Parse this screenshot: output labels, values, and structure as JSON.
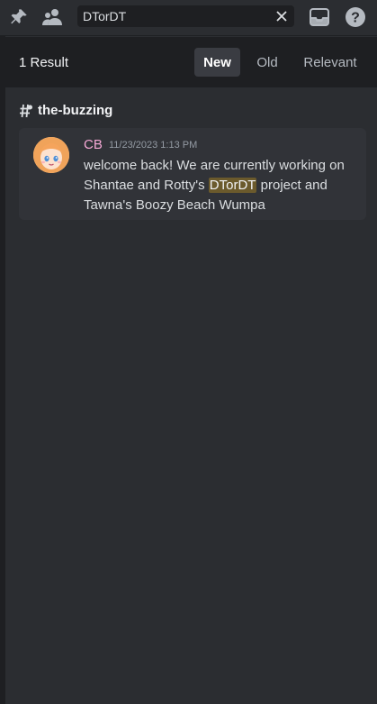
{
  "toolbar": {
    "pin_icon": "pin-icon",
    "members_icon": "members-icon",
    "inbox_icon": "inbox-icon",
    "help_icon": "help-icon"
  },
  "search": {
    "value": "DTorDT",
    "clear_icon": "close-icon"
  },
  "results": {
    "count_label": "1 Result",
    "sort_options": [
      "New",
      "Old",
      "Relevant"
    ],
    "active_sort": "New"
  },
  "channel": {
    "name": "the-buzzing"
  },
  "message": {
    "author": "CB",
    "timestamp": "11/23/2023 1:13 PM",
    "text_before": "welcome back! We are currently working on  Shantae and Rotty's ",
    "highlight": "DTorDT",
    "text_after": " project and Tawna's Boozy Beach Wumpa"
  },
  "colors": {
    "background": "#2b2d31",
    "header_bg": "#1e1f22",
    "card_bg": "#313338",
    "author": "#f5a8d5",
    "highlight": "#6b5a2c"
  }
}
